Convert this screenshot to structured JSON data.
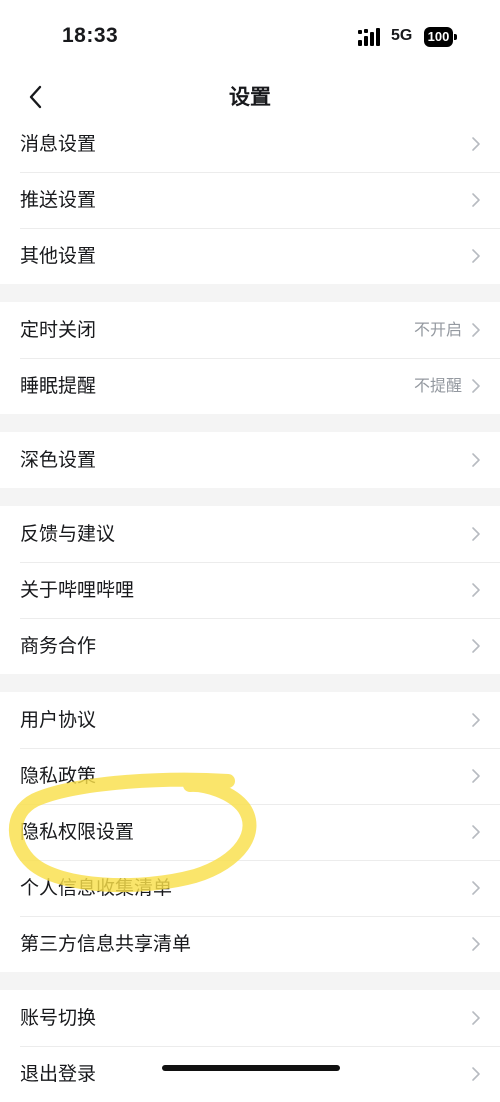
{
  "status_bar": {
    "time": "18:33",
    "network": "5G",
    "battery": "100",
    "icons": [
      "signal-icon",
      "battery-icon"
    ]
  },
  "nav": {
    "title": "设置",
    "back_icon": "chevron-left-icon"
  },
  "groups": [
    {
      "items": [
        {
          "label": "消息设置",
          "value": ""
        },
        {
          "label": "推送设置",
          "value": ""
        },
        {
          "label": "其他设置",
          "value": ""
        }
      ]
    },
    {
      "items": [
        {
          "label": "定时关闭",
          "value": "不开启"
        },
        {
          "label": "睡眠提醒",
          "value": "不提醒"
        }
      ]
    },
    {
      "items": [
        {
          "label": "深色设置",
          "value": ""
        }
      ]
    },
    {
      "items": [
        {
          "label": "反馈与建议",
          "value": ""
        },
        {
          "label": "关于哔哩哔哩",
          "value": ""
        },
        {
          "label": "商务合作",
          "value": ""
        }
      ]
    },
    {
      "items": [
        {
          "label": "用户协议",
          "value": ""
        },
        {
          "label": "隐私政策",
          "value": ""
        },
        {
          "label": "隐私权限设置",
          "value": ""
        },
        {
          "label": "个人信息收集清单",
          "value": ""
        },
        {
          "label": "第三方信息共享清单",
          "value": ""
        }
      ]
    },
    {
      "items": [
        {
          "label": "账号切换",
          "value": ""
        },
        {
          "label": "退出登录",
          "value": ""
        }
      ]
    }
  ],
  "colors": {
    "background": "#f4f4f4",
    "card": "#ffffff",
    "text": "#18191c",
    "secondary_text": "#9499a0",
    "chevron": "#b7bbc1",
    "highlight": "#f9df4a"
  }
}
